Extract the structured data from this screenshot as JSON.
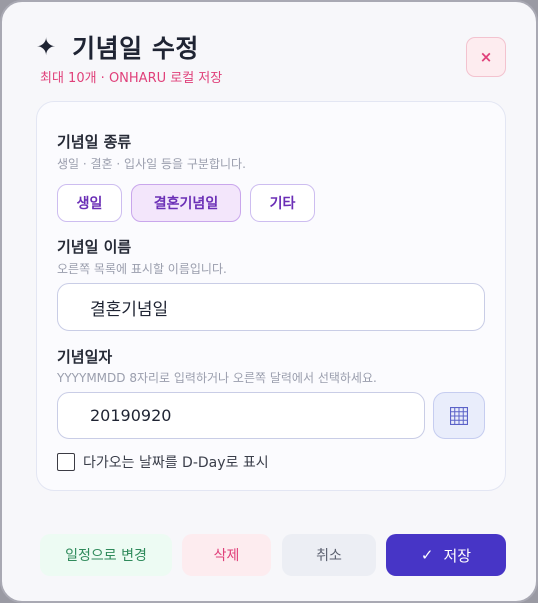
{
  "dialog": {
    "title": "기념일 수정",
    "subtitle": "최대 10개 · ONHARU 로컬 저장",
    "close_label": "×"
  },
  "type_section": {
    "label": "기념일 종류",
    "hint": "생일 · 결혼 · 입사일 등을 구분합니다.",
    "options": [
      "생일",
      "결혼기념일",
      "기타"
    ],
    "selected": "결혼기념일"
  },
  "name_section": {
    "label": "기념일 이름",
    "hint": "오른쪽 목록에 표시할 이름입니다.",
    "value": "결혼기념일"
  },
  "date_section": {
    "label": "기념일자",
    "hint": "YYYYMMDD 8자리로 입력하거나 오른쪽 달력에서 선택하세요.",
    "value": "20190920"
  },
  "dday": {
    "label": "다가오는 날짜를 D-Day로 표시",
    "checked": false
  },
  "footer": {
    "schedule_label": "일정으로 변경",
    "delete_label": "삭제",
    "cancel_label": "취소",
    "save_check": "✓",
    "save_label": "저장"
  },
  "colors": {
    "accent": "#4735c6",
    "danger": "#e0407a",
    "success": "#2f8a5b",
    "chip_text": "#6b2fb6"
  }
}
